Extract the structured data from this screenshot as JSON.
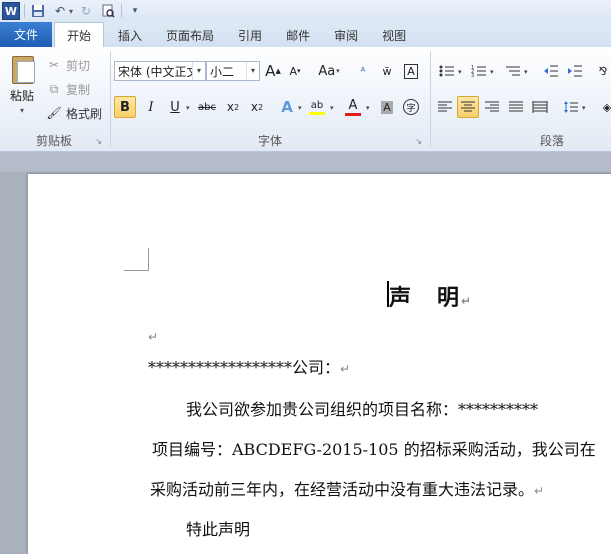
{
  "quick_access": {
    "logo": "W"
  },
  "tabs": [
    {
      "label": "文件"
    },
    {
      "label": "开始"
    },
    {
      "label": "插入"
    },
    {
      "label": "页面布局"
    },
    {
      "label": "引用"
    },
    {
      "label": "邮件"
    },
    {
      "label": "审阅"
    },
    {
      "label": "视图"
    }
  ],
  "clipboard": {
    "paste_label": "粘贴",
    "cut_label": "剪切",
    "copy_label": "复制",
    "format_painter_label": "格式刷",
    "group_label": "剪贴板"
  },
  "font": {
    "font_name": "宋体 (中文正文",
    "font_size": "小二",
    "grow": "A",
    "shrink": "A",
    "change_case": "Aa",
    "group_label": "字体"
  },
  "paragraph": {
    "group_label": "段落"
  },
  "document": {
    "title": "声　明",
    "line1": "******************公司：",
    "line2": "我公司欲参加贵公司组织的项目名称：**********",
    "line3": "项目编号：ABCDEFG-2015-105 的招标采购活动，我公司在",
    "line4": "采购活动前三年内，在经营活动中没有重大违法记录。",
    "line5": "特此声明"
  },
  "colors": {
    "file_tab": "#2b5ea8",
    "active_button": "#f8cf6a",
    "font_color_bar": "#e02020",
    "highlight_bar": "#ffff00"
  }
}
